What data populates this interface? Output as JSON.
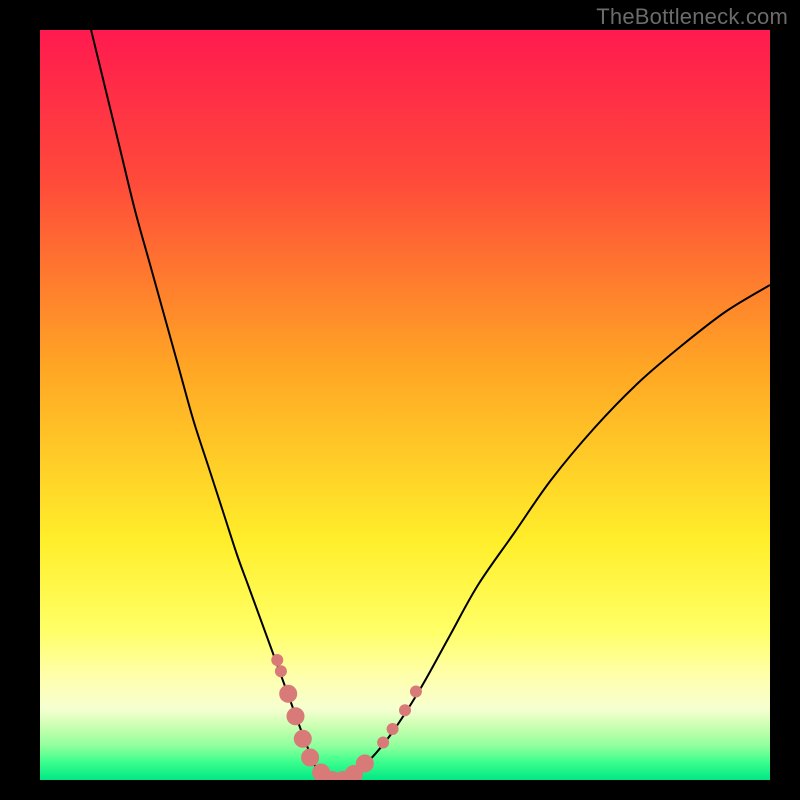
{
  "watermark": "TheBottleneck.com",
  "chart_data": {
    "type": "line",
    "title": "",
    "xlabel": "",
    "ylabel": "",
    "xlim": [
      0,
      100
    ],
    "ylim": [
      0,
      100
    ],
    "grid": false,
    "legend": false,
    "background_gradient": {
      "type": "vertical",
      "stops": [
        {
          "pos": 0.0,
          "color": "#ff1a4f"
        },
        {
          "pos": 0.2,
          "color": "#ff4a3a"
        },
        {
          "pos": 0.45,
          "color": "#ffa624"
        },
        {
          "pos": 0.68,
          "color": "#ffee2a"
        },
        {
          "pos": 0.8,
          "color": "#ffff66"
        },
        {
          "pos": 0.86,
          "color": "#ffffaa"
        },
        {
          "pos": 0.905,
          "color": "#f6ffd0"
        },
        {
          "pos": 0.93,
          "color": "#c7ffb0"
        },
        {
          "pos": 0.955,
          "color": "#8fff9c"
        },
        {
          "pos": 0.975,
          "color": "#3fff8e"
        },
        {
          "pos": 1.0,
          "color": "#00e884"
        }
      ]
    },
    "series": [
      {
        "name": "bottleneck-curve",
        "stroke": "#000000",
        "stroke_width": 2,
        "x": [
          7,
          9,
          11,
          13,
          15,
          17,
          19,
          21,
          23,
          25,
          27,
          28.5,
          30,
          31.5,
          33,
          34.5,
          36,
          37,
          38,
          39,
          42,
          45,
          48,
          52,
          56,
          60,
          65,
          70,
          76,
          82,
          88,
          94,
          100
        ],
        "y": [
          100,
          92,
          84,
          76,
          69,
          62,
          55,
          48,
          42,
          36,
          30,
          26,
          22,
          18,
          14,
          10,
          6,
          3.5,
          1.2,
          0,
          0,
          2.5,
          6,
          12,
          19,
          26,
          33,
          40,
          47,
          53,
          58,
          62.5,
          66
        ]
      }
    ],
    "markers": {
      "name": "highlight-dots",
      "color": "#d87a78",
      "radius_small": 6,
      "radius_large": 9,
      "points": [
        {
          "x": 32.5,
          "y": 16.0,
          "r": "small"
        },
        {
          "x": 33.0,
          "y": 14.5,
          "r": "small"
        },
        {
          "x": 34.0,
          "y": 11.5,
          "r": "large"
        },
        {
          "x": 35.0,
          "y": 8.5,
          "r": "large"
        },
        {
          "x": 36.0,
          "y": 5.5,
          "r": "large"
        },
        {
          "x": 37.0,
          "y": 3.0,
          "r": "large"
        },
        {
          "x": 38.5,
          "y": 1.0,
          "r": "large"
        },
        {
          "x": 40.0,
          "y": 0.0,
          "r": "large"
        },
        {
          "x": 41.5,
          "y": 0.0,
          "r": "large"
        },
        {
          "x": 43.0,
          "y": 0.8,
          "r": "large"
        },
        {
          "x": 44.5,
          "y": 2.2,
          "r": "large"
        },
        {
          "x": 47.0,
          "y": 5.0,
          "r": "small"
        },
        {
          "x": 48.3,
          "y": 6.8,
          "r": "small"
        },
        {
          "x": 50.0,
          "y": 9.3,
          "r": "small"
        },
        {
          "x": 51.5,
          "y": 11.8,
          "r": "small"
        }
      ]
    }
  }
}
